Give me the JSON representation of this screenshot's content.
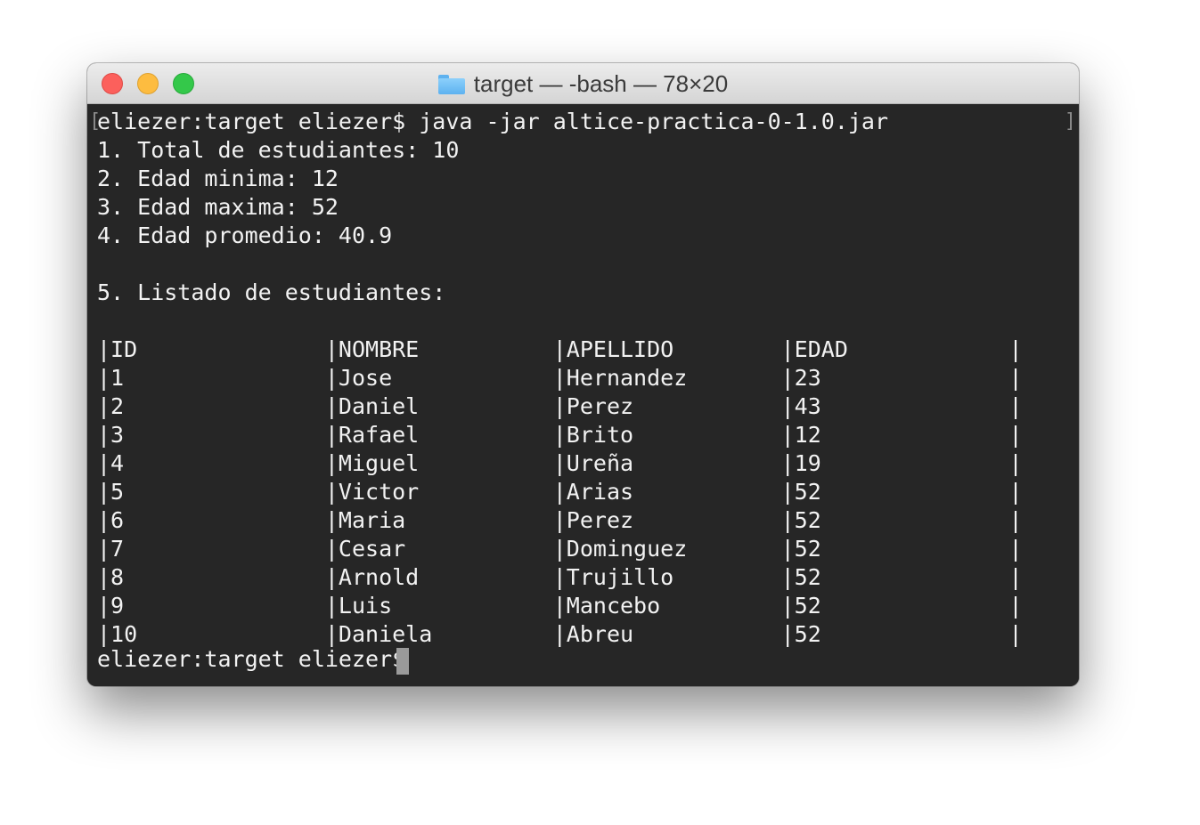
{
  "window": {
    "title": "target — -bash — 78×20",
    "folder_icon": "folder-icon"
  },
  "terminal": {
    "bracket_open": "[",
    "bracket_close": "]",
    "lines": [
      "eliezer:target eliezer$ java -jar altice-practica-0-1.0.jar",
      "1. Total de estudiantes: 10",
      "2. Edad minima: 12",
      "3. Edad maxima: 52",
      "4. Edad promedio: 40.9",
      "",
      "5. Listado de estudiantes:",
      "",
      "|ID              |NOMBRE          |APELLIDO        |EDAD            |",
      "|1               |Jose            |Hernandez       |23              |",
      "|2               |Daniel          |Perez           |43              |",
      "|3               |Rafael          |Brito           |12              |",
      "|4               |Miguel          |Ureña           |19              |",
      "|5               |Victor          |Arias           |52              |",
      "|6               |Maria           |Perez           |52              |",
      "|7               |Cesar           |Dominguez       |52              |",
      "|8               |Arnold          |Trujillo        |52              |",
      "|9               |Luis            |Mancebo         |52              |",
      "|10              |Daniela         |Abreu           |52              |"
    ],
    "prompt": "eliezer:target eliezer$ "
  }
}
